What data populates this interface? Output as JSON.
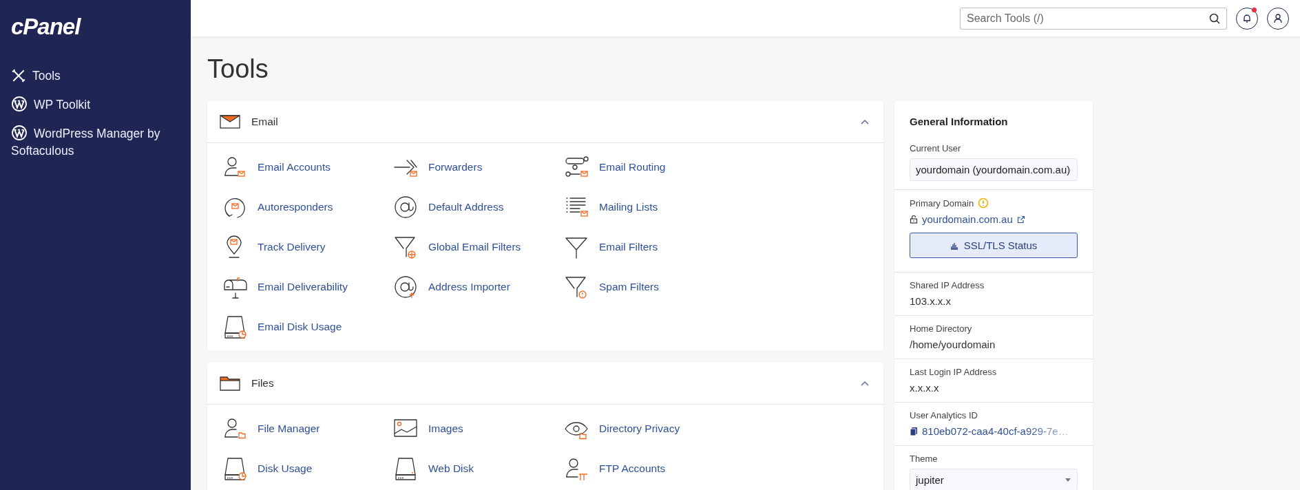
{
  "sidebar": {
    "logo": "cPanel",
    "items": [
      {
        "label": "Tools",
        "kind": "tools"
      },
      {
        "label": "WP Toolkit",
        "kind": "wordpress"
      },
      {
        "label": "WordPress Manager by Softaculous",
        "kind": "wordpress"
      }
    ]
  },
  "header": {
    "search": {
      "placeholder": "Search Tools (/)"
    },
    "notifications": {
      "unread": true
    }
  },
  "page_title": "Tools",
  "sections": [
    {
      "title": "Email",
      "kind": "envelope",
      "expanded": true,
      "tools": [
        {
          "label": "Email Accounts",
          "kind": "person-mail"
        },
        {
          "label": "Forwarders",
          "kind": "arrow-mail"
        },
        {
          "label": "Email Routing",
          "kind": "routing"
        },
        {
          "label": "Autoresponders",
          "kind": "cycle-mail"
        },
        {
          "label": "Default Address",
          "kind": "at"
        },
        {
          "label": "Mailing Lists",
          "kind": "list-mail"
        },
        {
          "label": "Track Delivery",
          "kind": "pin-mail"
        },
        {
          "label": "Global Email Filters",
          "kind": "funnel-globe"
        },
        {
          "label": "Email Filters",
          "kind": "funnel"
        },
        {
          "label": "Email Deliverability",
          "kind": "mailbox"
        },
        {
          "label": "Address Importer",
          "kind": "at-arrow"
        },
        {
          "label": "Spam Filters",
          "kind": "funnel-alert"
        },
        {
          "label": "Email Disk Usage",
          "kind": "drive-chart"
        }
      ]
    },
    {
      "title": "Files",
      "kind": "folder",
      "expanded": true,
      "tools": [
        {
          "label": "File Manager",
          "kind": "person-folder"
        },
        {
          "label": "Images",
          "kind": "image"
        },
        {
          "label": "Directory Privacy",
          "kind": "eye-folder"
        },
        {
          "label": "Disk Usage",
          "kind": "drive-chart"
        },
        {
          "label": "Web Disk",
          "kind": "drive"
        },
        {
          "label": "FTP Accounts",
          "kind": "person-ftp"
        }
      ]
    }
  ],
  "general_information": {
    "title": "General Information",
    "rows": [
      {
        "kind": "select",
        "label": "Current User",
        "value": "yourdomain (yourdomain.com.au)"
      },
      {
        "kind": "domain",
        "label": "Primary Domain",
        "warning": true,
        "value": "yourdomain.com.au",
        "button": "SSL/TLS Status"
      },
      {
        "kind": "text",
        "label": "Shared IP Address",
        "value": "103.x.x.x"
      },
      {
        "kind": "text",
        "label": "Home Directory",
        "value": "/home/yourdomain"
      },
      {
        "kind": "text",
        "label": "Last Login IP Address",
        "value": "x.x.x.x"
      },
      {
        "kind": "copy",
        "label": "User Analytics ID",
        "value": "810eb072-caa4-40cf-a929-7e…"
      },
      {
        "kind": "select",
        "label": "Theme",
        "value": "jupiter"
      }
    ]
  }
}
